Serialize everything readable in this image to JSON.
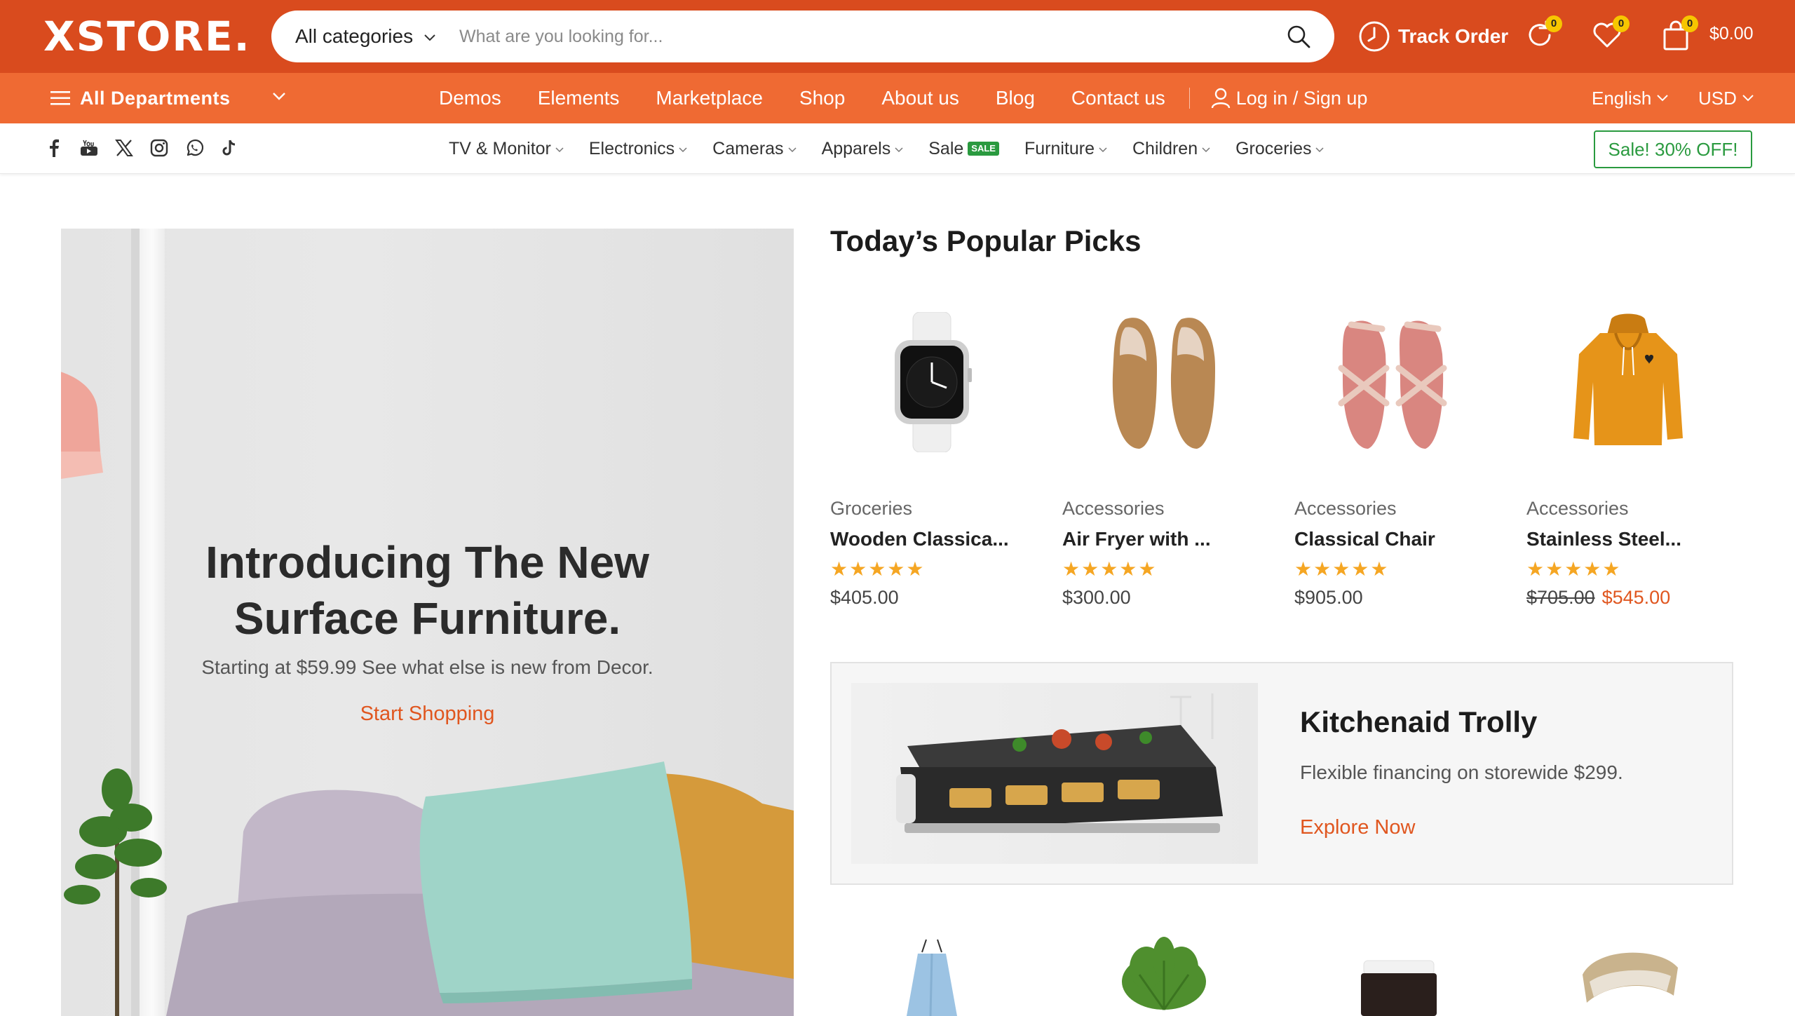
{
  "header": {
    "logo": "XSTORE.",
    "search": {
      "category": "All categories",
      "placeholder": "What are you looking for..."
    },
    "track_order": "Track Order",
    "compare_count": "0",
    "wishlist_count": "0",
    "cart_count": "0",
    "cart_total": "$0.00"
  },
  "nav": {
    "all_departments": "All Departments",
    "menu": [
      "Demos",
      "Elements",
      "Marketplace",
      "Shop",
      "About us",
      "Blog",
      "Contact us"
    ],
    "login": "Log in / Sign up",
    "language": "English",
    "currency": "USD"
  },
  "catbar": {
    "socials": [
      "facebook-icon",
      "youtube-icon",
      "x-icon",
      "instagram-icon",
      "whatsapp-icon",
      "tiktok-icon"
    ],
    "categories": [
      "TV & Monitor",
      "Electronics",
      "Cameras",
      "Apparels",
      "Sale",
      "Furniture",
      "Children",
      "Groceries"
    ],
    "sale_badge": "SALE",
    "promo": "Sale! 30% OFF!"
  },
  "hero": {
    "title_line1": "Introducing The New",
    "title_line2": "Surface Furniture.",
    "subtitle": "Starting at $59.99 See what else is new from Decor.",
    "cta": "Start Shopping"
  },
  "picks": {
    "title": "Today’s Popular Picks",
    "items": [
      {
        "category": "Groceries",
        "name": "Wooden Classica...",
        "rating": 5,
        "price": "$405.00",
        "image": "smartwatch"
      },
      {
        "category": "Accessories",
        "name": "Air Fryer with ...",
        "rating": 5,
        "price": "$300.00",
        "image": "loafers"
      },
      {
        "category": "Accessories",
        "name": "Classical Chair",
        "rating": 5,
        "price": "$905.00",
        "image": "sandals"
      },
      {
        "category": "Accessories",
        "name": "Stainless Steel...",
        "rating": 5,
        "old_price": "$705.00",
        "price": "$545.00",
        "image": "hoodie"
      }
    ],
    "stars": "★★★★★"
  },
  "promo_banner": {
    "title": "Kitchenaid Trolly",
    "subtitle": "Flexible financing on storewide $299.",
    "cta": "Explore Now"
  },
  "colors": {
    "brand_dark": "#d94b1e",
    "brand": "#ef6a33",
    "accent_text": "#e0561f",
    "sale_green": "#2a9a3f",
    "star": "#f5a623",
    "badge": "#f7c600"
  }
}
